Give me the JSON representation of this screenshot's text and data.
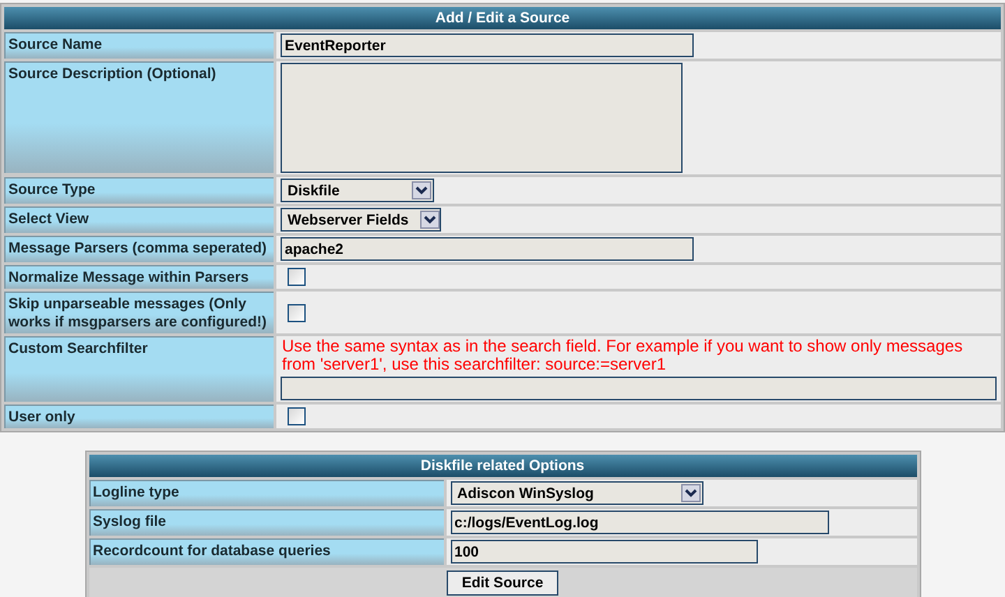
{
  "main": {
    "title": "Add / Edit a Source",
    "fields": [
      {
        "label": "Source Name",
        "kind": "text",
        "value": "EventReporter"
      },
      {
        "label": "Source Description (Optional)",
        "kind": "textarea"
      },
      {
        "label": "Source Type",
        "kind": "select",
        "value": "Diskfile"
      },
      {
        "label": "Select View",
        "kind": "select",
        "value": "Webserver Fields"
      },
      {
        "label": "Message Parsers (comma seperated)",
        "kind": "text",
        "value": "apache2"
      },
      {
        "label": "Normalize Message within Parsers",
        "kind": "checkbox",
        "checked": false
      },
      {
        "label": "Skip unparseable messages (Only works if msgparsers are configured!)",
        "kind": "checkbox",
        "checked": false
      },
      {
        "label": "Custom Searchfilter",
        "kind": "filter",
        "hint": "Use the same syntax as in the search field. For example if you want to show only messages from 'server1', use this searchfilter: source:=server1"
      },
      {
        "label": "User only",
        "kind": "checkbox",
        "checked": false
      }
    ]
  },
  "options": {
    "title": "Diskfile related Options",
    "fields": [
      {
        "label": "Logline type",
        "kind": "select",
        "value": "Adiscon WinSyslog"
      },
      {
        "label": "Syslog file",
        "kind": "text",
        "value": "c:/logs/EventLog.log"
      },
      {
        "label": "Recordcount for database queries",
        "kind": "text",
        "value": "100"
      }
    ],
    "button": "Edit Source"
  }
}
